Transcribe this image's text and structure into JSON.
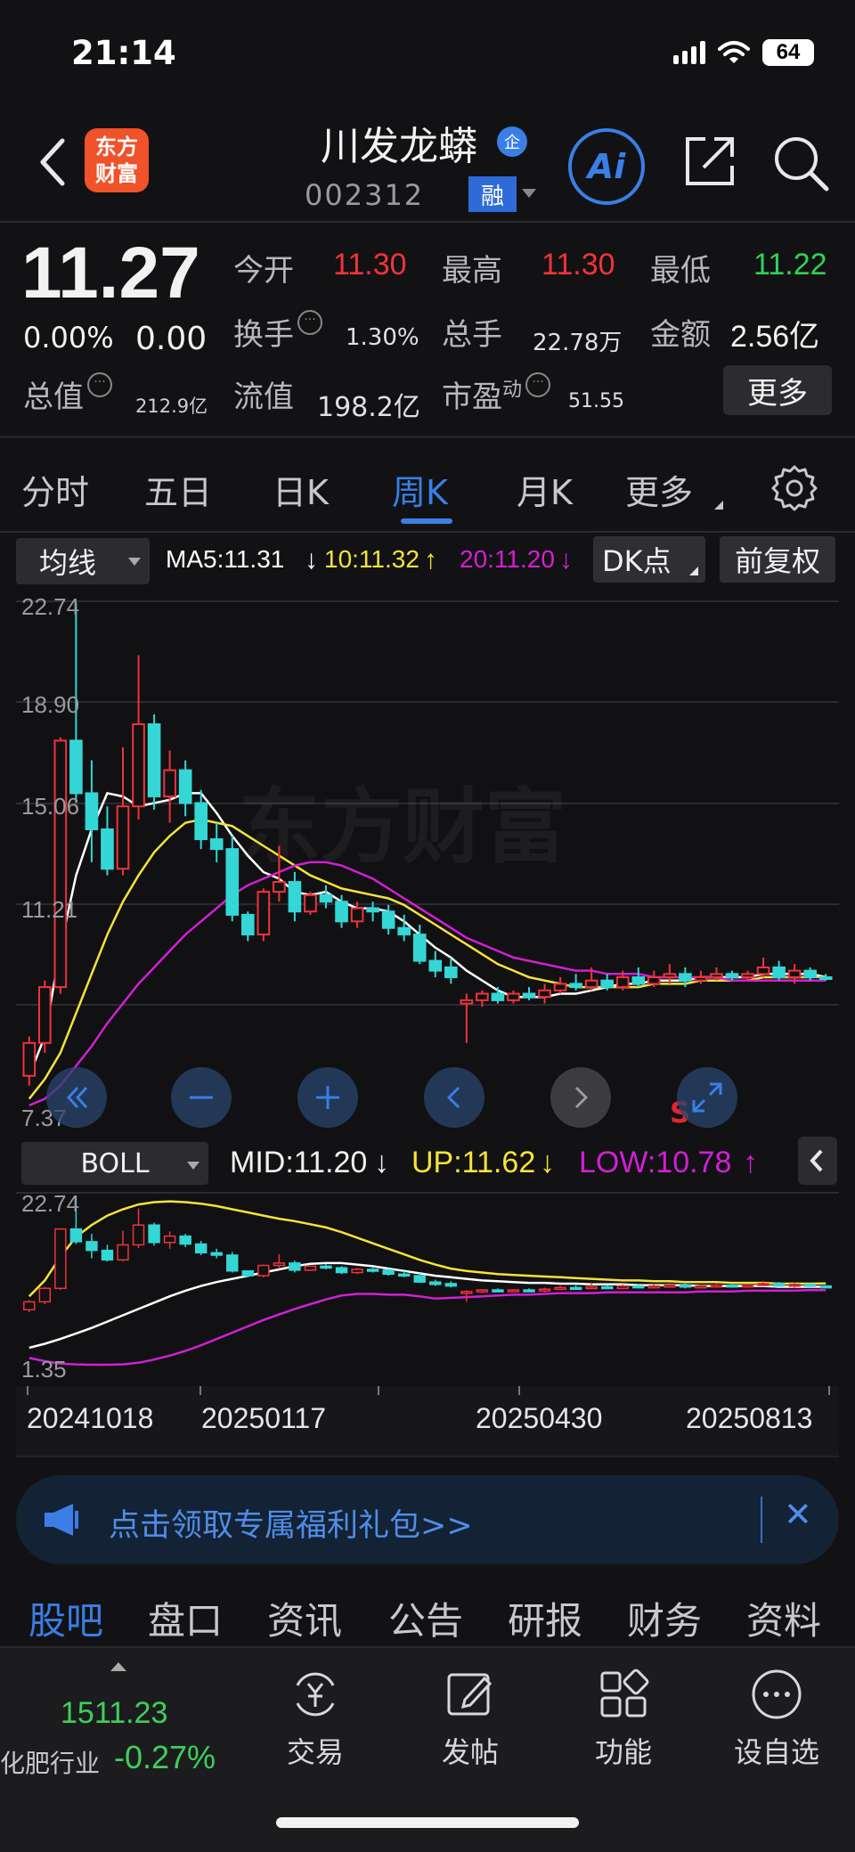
{
  "status_bar": {
    "time": "21:14",
    "battery": "64"
  },
  "header": {
    "logo_text": "东方\n财富",
    "stock_name": "川发龙蟒",
    "badge_qi": "企",
    "stock_code": "002312",
    "badge_rong": "融",
    "ai_label": "Ai"
  },
  "quote": {
    "price": "11.27",
    "change_pct": "0.00%",
    "change": "0.00",
    "fields": {
      "open_label": "今开",
      "open": "11.30",
      "high_label": "最高",
      "high": "11.30",
      "low_label": "最低",
      "low": "11.22",
      "turnover_label": "换手",
      "turnover": "1.30%",
      "volume_label": "总手",
      "volume": "22.78万",
      "amount_label": "金额",
      "amount": "2.56亿",
      "mktcap_label": "总值",
      "mktcap": "212.9亿",
      "float_label": "流值",
      "float": "198.2亿",
      "pe_label": "市盈",
      "pe_sup": "动",
      "pe": "51.55"
    },
    "more_button": "更多",
    "colors": {
      "up": "#f0333a",
      "down": "#2ed158"
    }
  },
  "period_tabs": [
    "分时",
    "五日",
    "日K",
    "周K",
    "月K",
    "更多"
  ],
  "active_period": "周K",
  "ma_bar": {
    "indicator_select": "均线",
    "ma5": "MA5:11.31",
    "ma10": "10:11.32",
    "ma20": "20:11.20",
    "dk_select": "DK点",
    "adjust_button": "前复权",
    "colors": {
      "ma5": "#ffffff",
      "ma10": "#f5e33a",
      "ma20": "#d21fd3"
    }
  },
  "main_chart_labels": [
    "22.74",
    "18.90",
    "15.06",
    "11.21",
    "7.37"
  ],
  "chart_markers": {
    "sell_marker": "S",
    "watermark": "东方财富"
  },
  "boll_bar": {
    "indicator_select": "BOLL",
    "mid": "MID:11.20",
    "up": "UP:11.62",
    "low": "LOW:10.78"
  },
  "boll_chart_labels": [
    "22.74",
    "1.35"
  ],
  "dates": [
    "20241018",
    "20250117",
    "20250430",
    "20250813"
  ],
  "banner": {
    "text": "点击领取专属福利礼包>>",
    "close": "✕"
  },
  "sub_tabs": [
    "股吧",
    "盘口",
    "资讯",
    "公告",
    "研报",
    "财务",
    "资料"
  ],
  "bottom_bar": {
    "index_value": "1511.23",
    "index_name": "化肥行业",
    "index_pct": "-0.27%",
    "items": [
      "交易",
      "发帖",
      "功能",
      "设自选"
    ]
  },
  "chart_data": {
    "type": "candlestick",
    "title": "",
    "period": "weekly",
    "x_labels": [
      "20241018",
      "20250117",
      "20250430",
      "20250813"
    ],
    "ylim": [
      7.37,
      22.74
    ],
    "y_ticks": [
      22.74,
      18.9,
      15.06,
      11.21,
      7.37
    ],
    "candles": [
      {
        "o": 8.3,
        "h": 9.5,
        "l": 8.0,
        "c": 9.3
      },
      {
        "o": 9.3,
        "h": 11.2,
        "l": 9.0,
        "c": 11.0
      },
      {
        "o": 11.0,
        "h": 18.6,
        "l": 10.8,
        "c": 18.5
      },
      {
        "o": 18.5,
        "h": 22.7,
        "l": 16.6,
        "c": 16.9
      },
      {
        "o": 16.9,
        "h": 17.9,
        "l": 14.8,
        "c": 15.8
      },
      {
        "o": 15.8,
        "h": 16.5,
        "l": 14.4,
        "c": 14.6
      },
      {
        "o": 14.6,
        "h": 18.3,
        "l": 14.4,
        "c": 16.5
      },
      {
        "o": 16.5,
        "h": 21.1,
        "l": 16.1,
        "c": 19.0
      },
      {
        "o": 19.0,
        "h": 19.3,
        "l": 16.4,
        "c": 16.8
      },
      {
        "o": 16.8,
        "h": 18.2,
        "l": 16.0,
        "c": 17.6
      },
      {
        "o": 17.6,
        "h": 17.9,
        "l": 16.2,
        "c": 16.6
      },
      {
        "o": 16.6,
        "h": 17.0,
        "l": 15.2,
        "c": 15.5
      },
      {
        "o": 15.5,
        "h": 16.0,
        "l": 14.8,
        "c": 15.2
      },
      {
        "o": 15.2,
        "h": 15.6,
        "l": 13.0,
        "c": 13.2
      },
      {
        "o": 13.2,
        "h": 13.3,
        "l": 12.4,
        "c": 12.6
      },
      {
        "o": 12.6,
        "h": 14.0,
        "l": 12.4,
        "c": 13.9
      },
      {
        "o": 13.9,
        "h": 15.3,
        "l": 13.6,
        "c": 14.2
      },
      {
        "o": 14.2,
        "h": 14.5,
        "l": 13.0,
        "c": 13.3
      },
      {
        "o": 13.3,
        "h": 13.9,
        "l": 13.2,
        "c": 13.8
      },
      {
        "o": 13.8,
        "h": 14.1,
        "l": 13.4,
        "c": 13.6
      },
      {
        "o": 13.6,
        "h": 13.8,
        "l": 12.8,
        "c": 13.0
      },
      {
        "o": 13.0,
        "h": 13.6,
        "l": 12.8,
        "c": 13.4
      },
      {
        "o": 13.4,
        "h": 13.6,
        "l": 13.0,
        "c": 13.3
      },
      {
        "o": 13.3,
        "h": 13.5,
        "l": 12.6,
        "c": 12.8
      },
      {
        "o": 12.8,
        "h": 13.2,
        "l": 12.4,
        "c": 12.6
      },
      {
        "o": 12.6,
        "h": 12.9,
        "l": 11.7,
        "c": 11.8
      },
      {
        "o": 11.8,
        "h": 12.1,
        "l": 11.3,
        "c": 11.5
      },
      {
        "o": 11.6,
        "h": 11.9,
        "l": 11.1,
        "c": 11.3
      },
      {
        "o": 10.5,
        "h": 10.8,
        "l": 9.3,
        "c": 10.6
      },
      {
        "o": 10.6,
        "h": 10.9,
        "l": 10.4,
        "c": 10.8
      },
      {
        "o": 10.8,
        "h": 11.0,
        "l": 10.5,
        "c": 10.6
      },
      {
        "o": 10.6,
        "h": 10.9,
        "l": 10.5,
        "c": 10.8
      },
      {
        "o": 10.8,
        "h": 11.0,
        "l": 10.6,
        "c": 10.7
      },
      {
        "o": 10.7,
        "h": 11.1,
        "l": 10.5,
        "c": 10.9
      },
      {
        "o": 10.9,
        "h": 11.3,
        "l": 10.8,
        "c": 11.1
      },
      {
        "o": 11.1,
        "h": 11.4,
        "l": 10.9,
        "c": 11.0
      },
      {
        "o": 11.0,
        "h": 11.6,
        "l": 10.9,
        "c": 11.2
      },
      {
        "o": 11.2,
        "h": 11.4,
        "l": 10.9,
        "c": 11.0
      },
      {
        "o": 11.0,
        "h": 11.5,
        "l": 10.9,
        "c": 11.3
      },
      {
        "o": 11.3,
        "h": 11.6,
        "l": 11.0,
        "c": 11.1
      },
      {
        "o": 11.1,
        "h": 11.5,
        "l": 11.0,
        "c": 11.3
      },
      {
        "o": 11.3,
        "h": 11.7,
        "l": 11.1,
        "c": 11.4
      },
      {
        "o": 11.4,
        "h": 11.6,
        "l": 11.0,
        "c": 11.2
      },
      {
        "o": 11.2,
        "h": 11.5,
        "l": 11.1,
        "c": 11.3
      },
      {
        "o": 11.3,
        "h": 11.6,
        "l": 11.2,
        "c": 11.4
      },
      {
        "o": 11.4,
        "h": 11.5,
        "l": 11.2,
        "c": 11.3
      },
      {
        "o": 11.3,
        "h": 11.5,
        "l": 11.2,
        "c": 11.4
      },
      {
        "o": 11.4,
        "h": 11.9,
        "l": 11.3,
        "c": 11.6
      },
      {
        "o": 11.6,
        "h": 11.8,
        "l": 11.2,
        "c": 11.3
      },
      {
        "o": 11.3,
        "h": 11.7,
        "l": 11.1,
        "c": 11.5
      },
      {
        "o": 11.5,
        "h": 11.6,
        "l": 11.2,
        "c": 11.3
      },
      {
        "o": 11.3,
        "h": 11.4,
        "l": 11.2,
        "c": 11.27
      }
    ],
    "series": [
      {
        "name": "MA5",
        "color": "#ffffff",
        "values": [
          8.3,
          9.5,
          12.2,
          14.4,
          15.8,
          16.9,
          16.8,
          16.5,
          16.6,
          16.7,
          16.9,
          16.9,
          16.3,
          15.6,
          15.0,
          14.5,
          14.3,
          13.9,
          13.8,
          13.9,
          13.6,
          13.4,
          13.4,
          13.3,
          13.0,
          12.6,
          12.2,
          11.9,
          11.5,
          11.2,
          10.9,
          10.7,
          10.7,
          10.7,
          10.8,
          10.8,
          10.9,
          11.0,
          11.1,
          11.1,
          11.2,
          11.2,
          11.2,
          11.3,
          11.3,
          11.3,
          11.3,
          11.4,
          11.4,
          11.4,
          11.4,
          11.31
        ]
      },
      {
        "name": "10",
        "color": "#f5e33a",
        "values": [
          7.6,
          8.2,
          9.0,
          10.2,
          11.4,
          12.6,
          13.6,
          14.4,
          15.1,
          15.6,
          16.0,
          16.1,
          16.0,
          15.9,
          15.6,
          15.3,
          15.0,
          14.7,
          14.4,
          14.2,
          14.0,
          13.9,
          13.8,
          13.7,
          13.5,
          13.2,
          12.9,
          12.6,
          12.3,
          12.0,
          11.7,
          11.5,
          11.3,
          11.2,
          11.1,
          11.0,
          11.0,
          11.0,
          11.0,
          11.0,
          11.1,
          11.1,
          11.1,
          11.2,
          11.2,
          11.2,
          11.2,
          11.3,
          11.3,
          11.3,
          11.3,
          11.32
        ]
      },
      {
        "name": "20",
        "color": "#d21fd3",
        "values": [
          7.4,
          7.6,
          8.0,
          8.6,
          9.2,
          9.9,
          10.5,
          11.1,
          11.6,
          12.1,
          12.6,
          13.0,
          13.4,
          13.8,
          14.1,
          14.3,
          14.5,
          14.7,
          14.8,
          14.8,
          14.7,
          14.5,
          14.3,
          14.0,
          13.7,
          13.4,
          13.1,
          12.8,
          12.5,
          12.3,
          12.1,
          11.9,
          11.8,
          11.7,
          11.6,
          11.5,
          11.5,
          11.4,
          11.4,
          11.4,
          11.3,
          11.3,
          11.3,
          11.3,
          11.3,
          11.2,
          11.2,
          11.2,
          11.2,
          11.2,
          11.2,
          11.2
        ]
      }
    ],
    "boll": {
      "ylim": [
        1.35,
        22.74
      ],
      "mid": {
        "name": "MID",
        "color": "#ffffff",
        "values": [
          3.5,
          4.0,
          4.6,
          5.3,
          6.0,
          6.8,
          7.6,
          8.4,
          9.2,
          10.0,
          10.7,
          11.3,
          11.8,
          12.2,
          12.6,
          13.0,
          13.4,
          13.8,
          14.1,
          14.2,
          14.2,
          14.0,
          13.8,
          13.5,
          13.2,
          12.9,
          12.6,
          12.4,
          12.2,
          12.0,
          11.9,
          11.8,
          11.7,
          11.7,
          11.6,
          11.6,
          11.5,
          11.5,
          11.5,
          11.4,
          11.4,
          11.4,
          11.4,
          11.3,
          11.3,
          11.3,
          11.3,
          11.3,
          11.2,
          11.2,
          11.2,
          11.2
        ]
      },
      "up": {
        "name": "UP",
        "color": "#f5e33a",
        "values": [
          10.0,
          12.0,
          15.0,
          17.5,
          19.0,
          20.2,
          21.0,
          21.6,
          21.9,
          22.0,
          21.9,
          21.7,
          21.4,
          21.0,
          20.6,
          20.2,
          19.8,
          19.5,
          19.1,
          18.7,
          18.1,
          17.4,
          16.7,
          16.0,
          15.3,
          14.6,
          14.0,
          13.5,
          13.2,
          13.0,
          12.8,
          12.7,
          12.6,
          12.5,
          12.4,
          12.3,
          12.2,
          12.1,
          12.0,
          12.0,
          11.9,
          11.9,
          11.8,
          11.8,
          11.8,
          11.7,
          11.7,
          11.7,
          11.6,
          11.6,
          11.6,
          11.62
        ]
      },
      "low": {
        "name": "LOW",
        "color": "#d21fd3",
        "values": [
          2.2,
          1.8,
          1.5,
          1.4,
          1.35,
          1.35,
          1.4,
          1.6,
          2.0,
          2.5,
          3.1,
          3.8,
          4.6,
          5.4,
          6.2,
          7.0,
          7.7,
          8.4,
          9.0,
          9.6,
          10.1,
          10.3,
          10.3,
          10.2,
          10.2,
          10.0,
          9.7,
          9.8,
          9.9,
          10.0,
          10.1,
          10.2,
          10.2,
          10.3,
          10.4,
          10.4,
          10.4,
          10.5,
          10.5,
          10.5,
          10.5,
          10.5,
          10.5,
          10.6,
          10.6,
          10.6,
          10.7,
          10.7,
          10.7,
          10.7,
          10.8,
          10.78
        ]
      }
    }
  }
}
